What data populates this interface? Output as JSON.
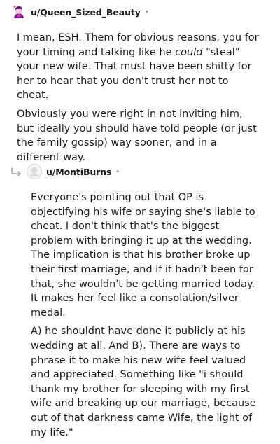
{
  "comments": [
    {
      "username": "u/Queen_Sized_Beauty",
      "separator": "•",
      "paragraphs": [
        {
          "before": "I mean, ESH. Them for obvious reasons, you for your timing and talking like he ",
          "emphasis": "could",
          "after": " \"steal\" your new wife. That must have been shitty for her to hear that you don't trust her not to cheat."
        },
        {
          "text": "Obviously you were right in not inviting him, but ideally you should have told people (or just the family gossip) way sooner, and in a different way."
        }
      ]
    },
    {
      "username": "u/MontiBurns",
      "separator": "•",
      "paragraphs": [
        {
          "text": "Everyone's pointing out that OP is objectifying his wife or saying she's liable to cheat. I don't think that's the biggest problem with bringing it up at the wedding. The implication is that his brother broke up their first marriage, and if it hadn't been for that, she wouldn't be getting married today. It makes her feel like a consolation/silver medal."
        },
        {
          "text": "A) he shouldnt have done it publicly at his wedding at all. And B). There are ways to phrase it to make his new wife feel valued and appreciated. Something like \"i should thank my brother for sleeping with my first wife and breaking up our marriage, because out of that darkness came Wife, the light of my life.\""
        }
      ]
    }
  ],
  "icons": {
    "avatar_1": "snoo-avatar-icon",
    "avatar_2": "default-avatar-icon",
    "reply": "reply-thread-icon"
  },
  "colors": {
    "text": "#1c1c1c",
    "meta": "#878a8c",
    "avatar_1_primary": "#7a1fa2",
    "avatar_1_accent": "#d93a7a"
  }
}
